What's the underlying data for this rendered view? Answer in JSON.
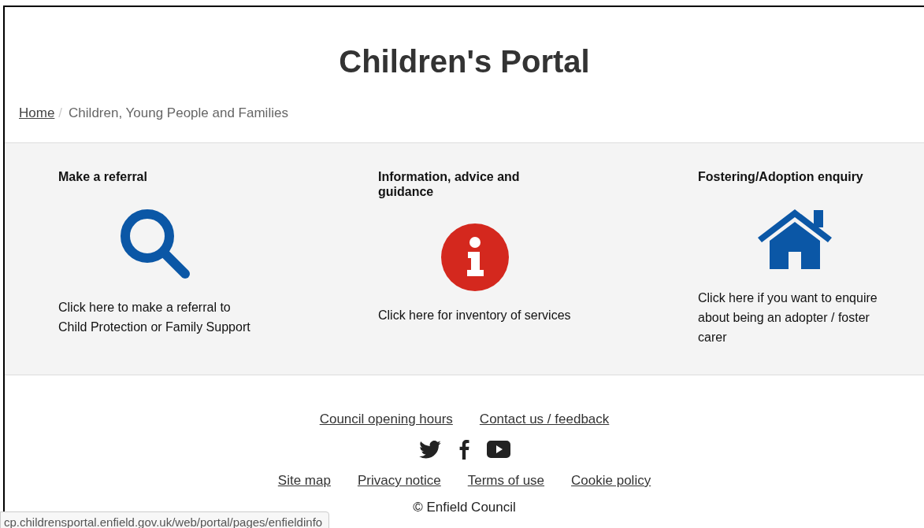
{
  "title": "Children's Portal",
  "breadcrumb_separator": "/",
  "breadcrumb": [
    {
      "label": "Home",
      "kind": "link"
    },
    {
      "label": "Children, Young People and Families",
      "kind": "current"
    }
  ],
  "cards": [
    {
      "heading": "Make a referral",
      "text": "Click here to make a referral to Child Protection or Family Support"
    },
    {
      "heading": "Information, advice and guidance",
      "text": "Click here for inventory of services"
    },
    {
      "heading": "Fostering/Adoption enquiry",
      "text": "Click here if you want to enquire about being an adopter / foster carer"
    }
  ],
  "footer": {
    "links_top": [
      "Council opening hours",
      "Contact us / feedback"
    ],
    "links_bottom": [
      "Site map",
      "Privacy notice",
      "Terms of use",
      "Cookie policy"
    ],
    "copyright": "© Enfield Council"
  },
  "status_bar": {
    "url": "cp.childrensportal.enfield.gov.uk/web/portal/pages/enfieldinfo"
  }
}
